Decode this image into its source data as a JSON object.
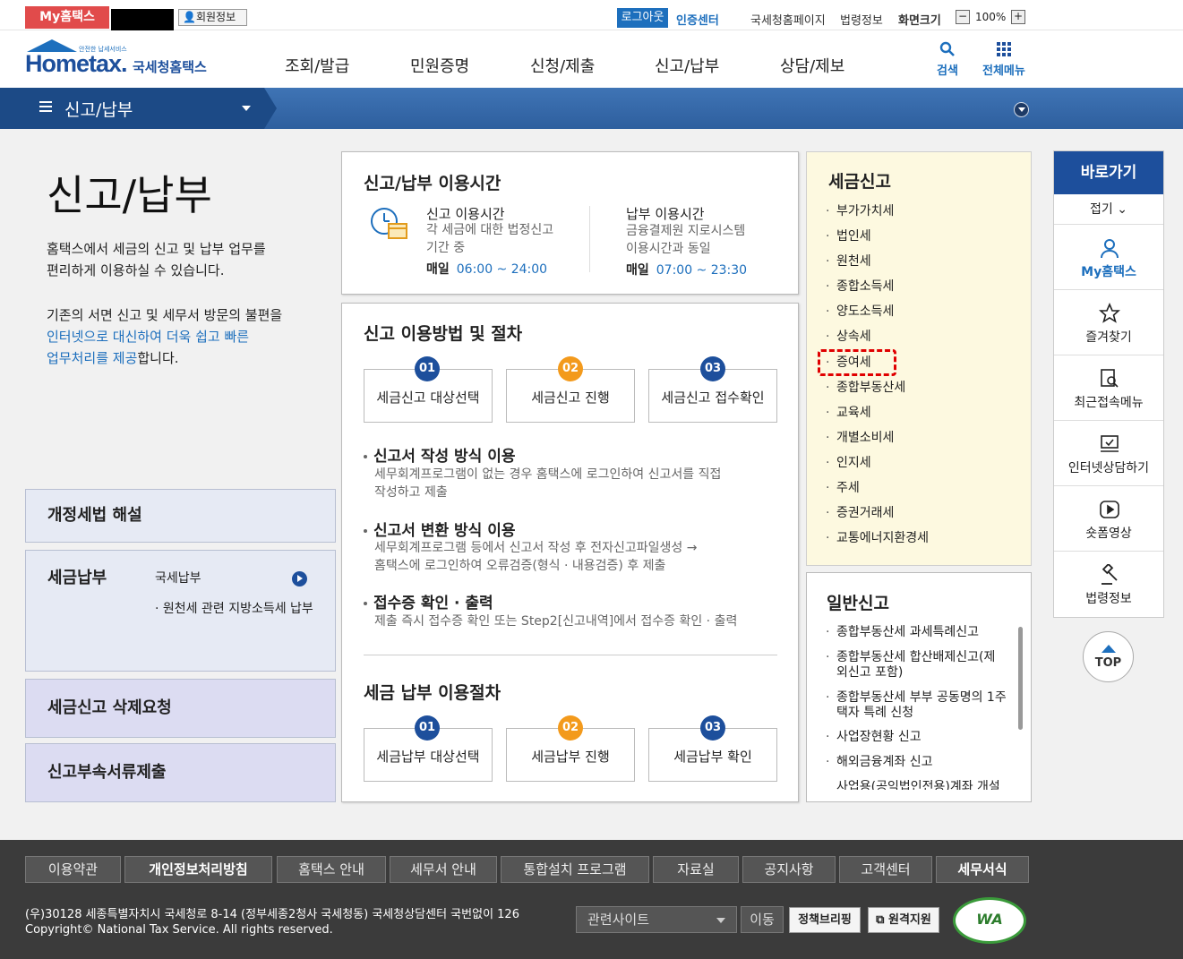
{
  "topbar": {
    "my_tab": "My홈택스",
    "user_info": "회원정보",
    "logout": "로그아웃",
    "cert_center": "인증센터",
    "links": [
      "국세청홈페이지",
      "법령정보",
      "화면크기"
    ],
    "zoom": "100%",
    "zoom_minus": "−",
    "zoom_plus": "+"
  },
  "logo": {
    "small": "안전한 납세서비스",
    "brand": "Hometax.",
    "brand_ko": "국세청홈택스"
  },
  "gnb": {
    "menus": [
      "조회/발급",
      "민원증명",
      "신청/제출",
      "신고/납부",
      "상담/제보"
    ],
    "search": "검색",
    "all_menu": "전체메뉴"
  },
  "lnb": {
    "title": "신고/납부"
  },
  "intro": {
    "title": "신고/납부",
    "p1_l1": "홈택스에서 세금의 신고 및 납부 업무를",
    "p1_l2": "편리하게 이용하실 수 있습니다.",
    "p2_l1": "기존의 서면 신고 및 세무서 방문의 불편을",
    "p2_l2": "인터넷으로 대신하여 더욱 쉽고 빠른",
    "p2_l3a": "업무처리를 제공",
    "p2_l3b": "합니다."
  },
  "leftboxes": {
    "revision": "개정세법 해설",
    "payment": "세금납부",
    "payment_items": [
      "국세납부",
      "원천세 관련 지방소득세 납부"
    ],
    "delete_request": "세금신고 삭제요청",
    "attach_submit": "신고부속서류제출"
  },
  "hours": {
    "title": "신고/납부 이용시간",
    "report_h": "신고 이용시간",
    "report_d1": "각 세금에 대한 법정신고",
    "report_d2": "기간 중",
    "report_daily": "매일",
    "report_time": "06:00 ~ 24:00",
    "pay_h": "납부 이용시간",
    "pay_d1": "금융결제원 지로시스템",
    "pay_d2": "이용시간과 동일",
    "pay_daily": "매일",
    "pay_time": "07:00 ~ 23:30"
  },
  "procedure": {
    "title": "신고 이용방법 및 절차",
    "steps": [
      {
        "num": "01",
        "label": "세금신고 대상선택"
      },
      {
        "num": "02",
        "label": "세금신고 진행"
      },
      {
        "num": "03",
        "label": "세금신고 접수확인"
      }
    ],
    "b1_h": "신고서 작성 방식 이용",
    "b1_d1": "세무회계프로그램이 없는 경우 홈택스에 로그인하여 신고서를 직접",
    "b1_d2": "작성하고 제출",
    "b2_h": "신고서 변환 방식 이용",
    "b2_d1": "세무회계프로그램 등에서 신고서 작성 후 전자신고파일생성 →",
    "b2_d2": "홈택스에 로그인하여 오류검증(형식 · 내용검증) 후 제출",
    "b3_h": "접수증 확인 · 출력",
    "b3_d1": "제출 즉시 접수증 확인 또는 Step2[신고내역]에서 접수증 확인 · 출력",
    "pay_title": "세금 납부 이용절차",
    "pay_steps": [
      {
        "num": "01",
        "label": "세금납부 대상선택"
      },
      {
        "num": "02",
        "label": "세금납부 진행"
      },
      {
        "num": "03",
        "label": "세금납부 확인"
      }
    ]
  },
  "taxreport": {
    "title": "세금신고",
    "items": [
      "부가가치세",
      "법인세",
      "원천세",
      "종합소득세",
      "양도소득세",
      "상속세",
      "증여세",
      "종합부동산세",
      "교육세",
      "개별소비세",
      "인지세",
      "주세",
      "증권거래세",
      "교통에너지환경세"
    ]
  },
  "general": {
    "title": "일반신고",
    "items": [
      "종합부동산세 과세특례신고",
      "종합부동산세 합산배제신고(제",
      "외신고 포함)",
      "종합부동산세 부부 공동명의 1주",
      "택자 특례 신청",
      "사업장현황 신고",
      "해외금융계좌 신고",
      "사업용(공익법인전용)계좌 개설"
    ]
  },
  "quick": {
    "title": "바로가기",
    "fold": "접기",
    "items": [
      "My홈택스",
      "즐겨찾기",
      "최근접속메뉴",
      "인터넷상담하기",
      "숏폼영상",
      "법령정보"
    ],
    "top": "TOP"
  },
  "footer": {
    "links": [
      "이용약관",
      "개인정보처리방침",
      "홈택스 안내",
      "세무서 안내",
      "통합설치 프로그램",
      "자료실",
      "공지사항",
      "고객센터",
      "세무서식"
    ],
    "addr1": "(우)30128 세종특별자치시 국세청로 8-14 (정부세종2청사 국세청동) 국세청상담센터 국번없이 126",
    "addr2": "Copyright© National Tax Service. All rights reserved.",
    "related": "관련사이트",
    "move": "이동",
    "policy": "정책브리핑",
    "remote": "원격지원",
    "wa": "WA"
  },
  "colors": {
    "brand": "#1d4f9c",
    "accent": "#1d6fbd",
    "orange": "#f39a1c",
    "highlight": "#e00000"
  }
}
